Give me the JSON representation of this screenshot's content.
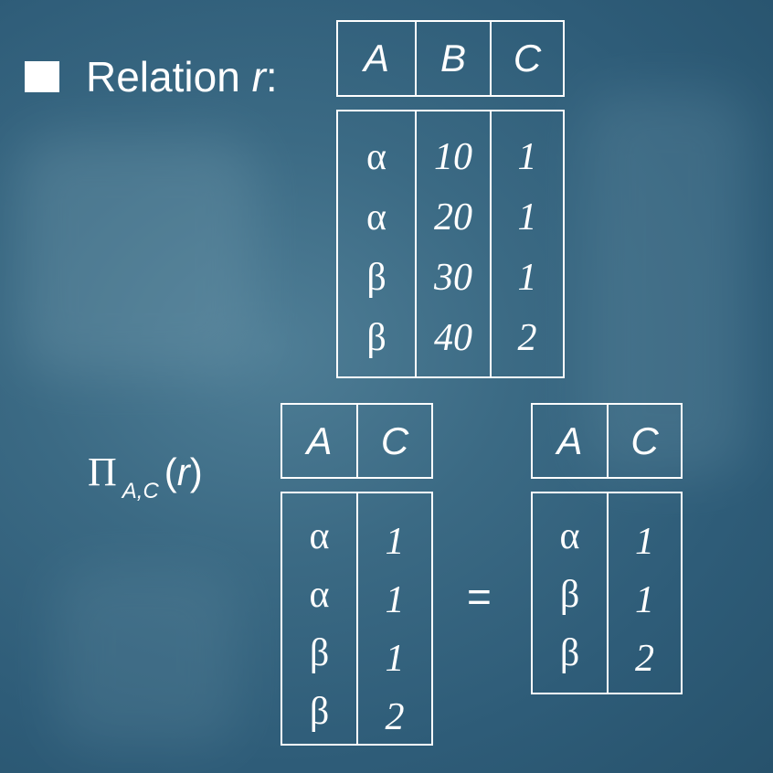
{
  "slide": {
    "relation_label": "Relation",
    "relation_name": "r",
    "relation_colon": ":",
    "projection": {
      "operator": "Π",
      "subscript": "A,C",
      "arg_open": "(",
      "arg": "r",
      "arg_close": ")"
    },
    "equals": "="
  },
  "relation_r": {
    "columns": [
      "A",
      "B",
      "C"
    ],
    "rows": [
      [
        "α",
        "10",
        "1"
      ],
      [
        "α",
        "20",
        "1"
      ],
      [
        "β",
        "30",
        "1"
      ],
      [
        "β",
        "40",
        "2"
      ]
    ]
  },
  "projection_result": {
    "columns": [
      "A",
      "C"
    ],
    "rows": [
      [
        "α",
        "1"
      ],
      [
        "α",
        "1"
      ],
      [
        "β",
        "1"
      ],
      [
        "β",
        "2"
      ]
    ]
  },
  "projection_dedup": {
    "columns": [
      "A",
      "C"
    ],
    "rows": [
      [
        "α",
        "1"
      ],
      [
        "β",
        "1"
      ],
      [
        "β",
        "2"
      ]
    ]
  }
}
